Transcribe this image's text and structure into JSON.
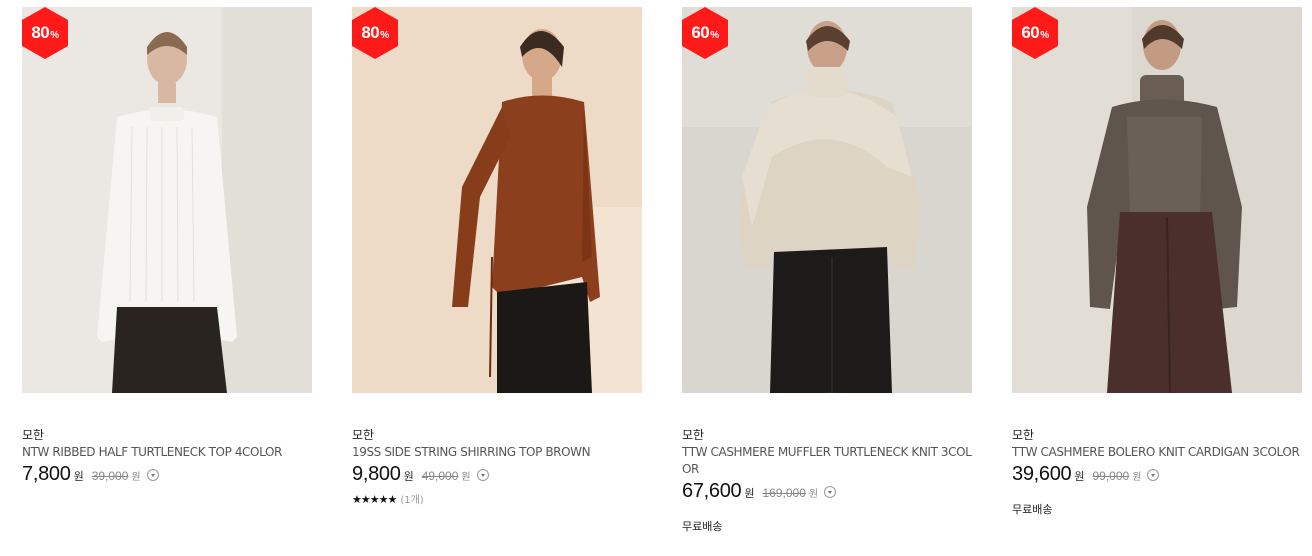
{
  "products": [
    {
      "badge_value": "80",
      "badge_unit": "%",
      "brand": "모한",
      "title": "NTW RIBBED HALF TURTLENECK TOP 4COLOR",
      "price": "7,800",
      "price_unit": "원",
      "original_price": "39,000",
      "original_unit": "원",
      "rating_stars": "",
      "rating_count": "",
      "shipping": ""
    },
    {
      "badge_value": "80",
      "badge_unit": "%",
      "brand": "모한",
      "title": "19SS SIDE STRING SHIRRING TOP BROWN",
      "price": "9,800",
      "price_unit": "원",
      "original_price": "49,000",
      "original_unit": "원",
      "rating_stars": "★★★★★",
      "rating_count": "(1개)",
      "shipping": ""
    },
    {
      "badge_value": "60",
      "badge_unit": "%",
      "brand": "모한",
      "title": "TTW CASHMERE MUFFLER TURTLENECK KNIT 3COLOR",
      "price": "67,600",
      "price_unit": "원",
      "original_price": "169,000",
      "original_unit": "원",
      "rating_stars": "",
      "rating_count": "",
      "shipping": "무료배송"
    },
    {
      "badge_value": "60",
      "badge_unit": "%",
      "brand": "모한",
      "title": "TTW CASHMERE BOLERO KNIT CARDIGAN 3COLOR",
      "price": "39,600",
      "price_unit": "원",
      "original_price": "99,000",
      "original_unit": "원",
      "rating_stars": "",
      "rating_count": "",
      "shipping": "무료배송"
    }
  ],
  "colors": {
    "badge": "#ff1a1a",
    "price": "#111111",
    "original_price": "#888888"
  }
}
